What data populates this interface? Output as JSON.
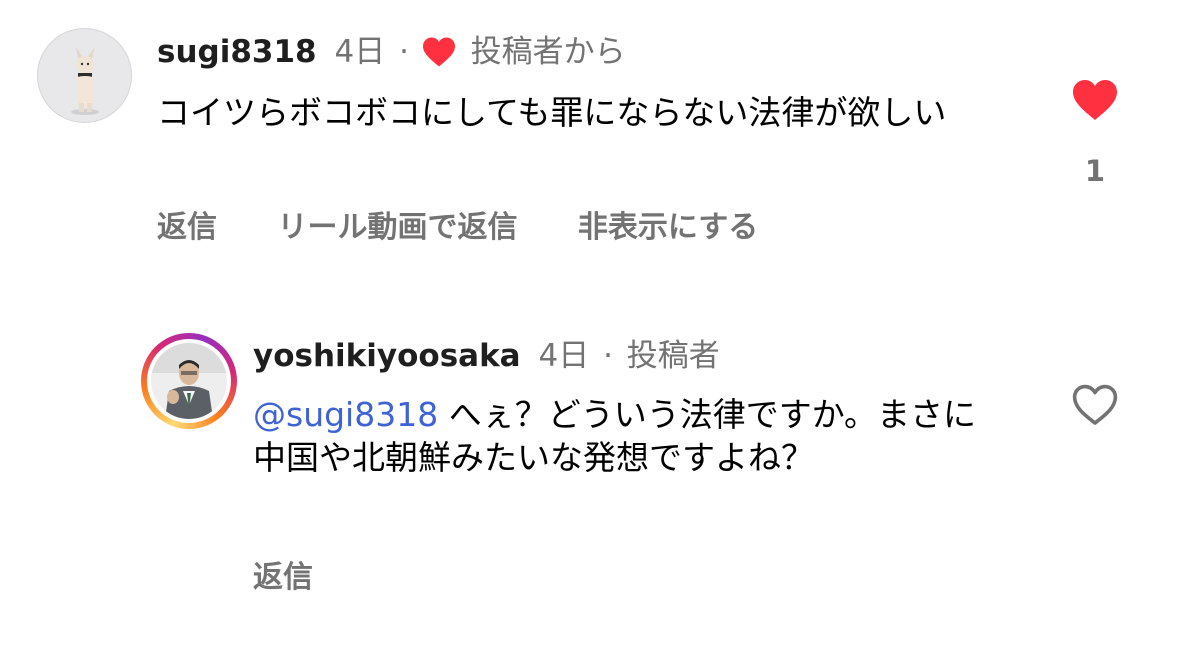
{
  "comments": [
    {
      "username": "sugi8318",
      "time": "4日",
      "separator": "·",
      "badge": "投稿者から",
      "text": "コイツらボコボコにしても罪にならない法律が欲しい",
      "like_count": "1",
      "liked": true,
      "actions": {
        "reply": "返信",
        "reel_reply": "リール動画で返信",
        "hide": "非表示にする"
      }
    },
    {
      "username": "yoshikiyoosaka",
      "time": "4日",
      "separator": "·",
      "badge": "投稿者",
      "mention": "@sugi8318",
      "text": " へぇ？どういう法律ですか。まさに中国や北朝鮮みたいな発想ですよね？",
      "liked": false,
      "actions": {
        "reply": "返信"
      }
    }
  ],
  "icons": [
    "heart-filled-icon",
    "heart-outline-icon"
  ],
  "colors": {
    "like_red": "#ff3040",
    "mention_blue": "#3f63d6",
    "muted": "#737373"
  }
}
